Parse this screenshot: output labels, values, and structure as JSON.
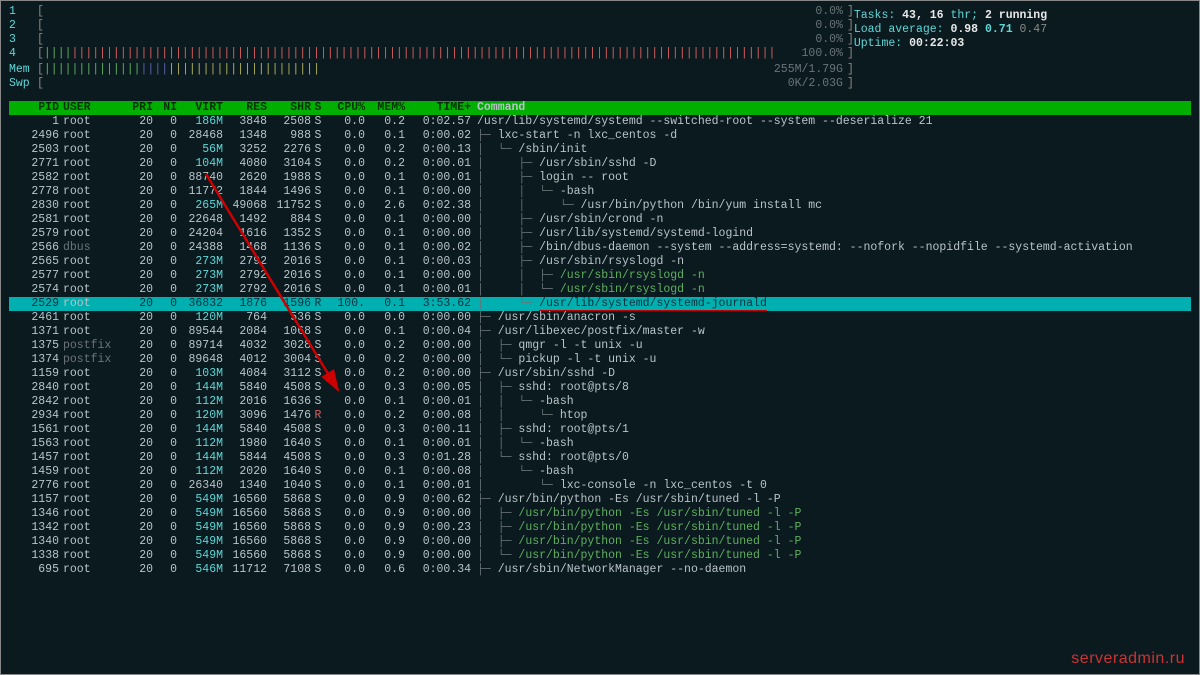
{
  "meters": {
    "cpus": [
      {
        "label": "1",
        "pct": "0.0%"
      },
      {
        "label": "2",
        "pct": "0.0%"
      },
      {
        "label": "3",
        "pct": "0.0%"
      },
      {
        "label": "4",
        "pct": "100.0%"
      }
    ],
    "mem": {
      "label": "Mem",
      "used": "255M",
      "total": "1.79G"
    },
    "swap": {
      "label": "Swp",
      "used": "0K",
      "total": "2.03G"
    }
  },
  "info": {
    "tasks_label": "Tasks: ",
    "tasks": "43, 16",
    "thr_label": " thr; ",
    "running": "2 running",
    "load_label": "Load average: ",
    "load1": "0.98",
    "load2": "0.71",
    "load3": "0.47",
    "uptime_label": "Uptime: ",
    "uptime": "00:22:03"
  },
  "headers": {
    "pid": "PID",
    "user": "USER",
    "pri": "PRI",
    "ni": "NI",
    "virt": "VIRT",
    "res": "RES",
    "shr": "SHR",
    "s": "S",
    "cpu": "CPU%",
    "mem": "MEM%",
    "time": "TIME+",
    "cmd": "Command"
  },
  "watermark": "serveradmin.ru",
  "procs": [
    {
      "pid": "1",
      "user": "root",
      "pri": "20",
      "ni": "0",
      "virt": "186M",
      "res": "3848",
      "shr": "2508",
      "s": "S",
      "cpu": "0.0",
      "mem": "0.2",
      "time": "0:02.57",
      "tree": "",
      "cmd": "/usr/lib/systemd/systemd --switched-root --system --deserialize 21"
    },
    {
      "pid": "2496",
      "user": "root",
      "pri": "20",
      "ni": "0",
      "virt": "28468",
      "res": "1348",
      "shr": "988",
      "s": "S",
      "cpu": "0.0",
      "mem": "0.1",
      "time": "0:00.02",
      "tree": "├─ ",
      "cmd": "lxc-start -n lxc_centos -d"
    },
    {
      "pid": "2503",
      "user": "root",
      "pri": "20",
      "ni": "0",
      "virt": "56M",
      "res": "3252",
      "shr": "2276",
      "s": "S",
      "cpu": "0.0",
      "mem": "0.2",
      "time": "0:00.13",
      "tree": "│  └─ ",
      "cmd": "/sbin/init"
    },
    {
      "pid": "2771",
      "user": "root",
      "pri": "20",
      "ni": "0",
      "virt": "104M",
      "res": "4080",
      "shr": "3104",
      "s": "S",
      "cpu": "0.0",
      "mem": "0.2",
      "time": "0:00.01",
      "tree": "│     ├─ ",
      "cmd": "/usr/sbin/sshd -D"
    },
    {
      "pid": "2582",
      "user": "root",
      "pri": "20",
      "ni": "0",
      "virt": "88740",
      "res": "2620",
      "shr": "1988",
      "s": "S",
      "cpu": "0.0",
      "mem": "0.1",
      "time": "0:00.01",
      "tree": "│     ├─ ",
      "cmd": "login -- root"
    },
    {
      "pid": "2778",
      "user": "root",
      "pri": "20",
      "ni": "0",
      "virt": "11772",
      "res": "1844",
      "shr": "1496",
      "s": "S",
      "cpu": "0.0",
      "mem": "0.1",
      "time": "0:00.00",
      "tree": "│     │  └─ ",
      "cmd": "-bash"
    },
    {
      "pid": "2830",
      "user": "root",
      "pri": "20",
      "ni": "0",
      "virt": "265M",
      "res": "49068",
      "shr": "11752",
      "s": "S",
      "cpu": "0.0",
      "mem": "2.6",
      "time": "0:02.38",
      "tree": "│     │     └─ ",
      "cmd": "/usr/bin/python /bin/yum install mc"
    },
    {
      "pid": "2581",
      "user": "root",
      "pri": "20",
      "ni": "0",
      "virt": "22648",
      "res": "1492",
      "shr": "884",
      "s": "S",
      "cpu": "0.0",
      "mem": "0.1",
      "time": "0:00.00",
      "tree": "│     ├─ ",
      "cmd": "/usr/sbin/crond -n"
    },
    {
      "pid": "2579",
      "user": "root",
      "pri": "20",
      "ni": "0",
      "virt": "24204",
      "res": "1616",
      "shr": "1352",
      "s": "S",
      "cpu": "0.0",
      "mem": "0.1",
      "time": "0:00.00",
      "tree": "│     ├─ ",
      "cmd": "/usr/lib/systemd/systemd-logind"
    },
    {
      "pid": "2566",
      "user": "dbus",
      "userDim": true,
      "pri": "20",
      "ni": "0",
      "virt": "24388",
      "res": "1468",
      "shr": "1136",
      "s": "S",
      "cpu": "0.0",
      "mem": "0.1",
      "time": "0:00.02",
      "tree": "│     ├─ ",
      "cmd": "/bin/dbus-daemon --system --address=systemd: --nofork --nopidfile --systemd-activation"
    },
    {
      "pid": "2565",
      "user": "root",
      "pri": "20",
      "ni": "0",
      "virt": "273M",
      "res": "2792",
      "shr": "2016",
      "s": "S",
      "cpu": "0.0",
      "mem": "0.1",
      "time": "0:00.03",
      "tree": "│     ├─ ",
      "cmd": "/usr/sbin/rsyslogd -n"
    },
    {
      "pid": "2577",
      "user": "root",
      "pri": "20",
      "ni": "0",
      "virt": "273M",
      "res": "2792",
      "shr": "2016",
      "s": "S",
      "cpu": "0.0",
      "mem": "0.1",
      "time": "0:00.00",
      "tree": "│     │  ├─ ",
      "cmd": "/usr/sbin/rsyslogd -n",
      "cmdGreen": true
    },
    {
      "pid": "2574",
      "user": "root",
      "pri": "20",
      "ni": "0",
      "virt": "273M",
      "res": "2792",
      "shr": "2016",
      "s": "S",
      "cpu": "0.0",
      "mem": "0.1",
      "time": "0:00.01",
      "tree": "│     │  └─ ",
      "cmd": "/usr/sbin/rsyslogd -n",
      "cmdGreen": true
    },
    {
      "pid": "2529",
      "user": "root",
      "pri": "20",
      "ni": "0",
      "virt": "36832",
      "res": "1876",
      "shr": "1596",
      "s": "R",
      "cpu": "100.",
      "mem": "0.1",
      "time": "3:53.62",
      "tree": "│     └─ ",
      "cmd": "/usr/lib/systemd/systemd-journald",
      "hl": true,
      "underline": true
    },
    {
      "pid": "2461",
      "user": "root",
      "pri": "20",
      "ni": "0",
      "virt": "120M",
      "res": "764",
      "shr": "536",
      "s": "S",
      "cpu": "0.0",
      "mem": "0.0",
      "time": "0:00.00",
      "tree": "├─ ",
      "cmd": "/usr/sbin/anacron -s"
    },
    {
      "pid": "1371",
      "user": "root",
      "pri": "20",
      "ni": "0",
      "virt": "89544",
      "res": "2084",
      "shr": "1068",
      "s": "S",
      "cpu": "0.0",
      "mem": "0.1",
      "time": "0:00.04",
      "tree": "├─ ",
      "cmd": "/usr/libexec/postfix/master -w"
    },
    {
      "pid": "1375",
      "user": "postfix",
      "userDim": true,
      "pri": "20",
      "ni": "0",
      "virt": "89714",
      "res": "4032",
      "shr": "3028",
      "s": "S",
      "cpu": "0.0",
      "mem": "0.2",
      "time": "0:00.00",
      "tree": "│  ├─ ",
      "cmd": "qmgr -l -t unix -u"
    },
    {
      "pid": "1374",
      "user": "postfix",
      "userDim": true,
      "pri": "20",
      "ni": "0",
      "virt": "89648",
      "res": "4012",
      "shr": "3004",
      "s": "S",
      "cpu": "0.0",
      "mem": "0.2",
      "time": "0:00.00",
      "tree": "│  └─ ",
      "cmd": "pickup -l -t unix -u"
    },
    {
      "pid": "1159",
      "user": "root",
      "pri": "20",
      "ni": "0",
      "virt": "103M",
      "res": "4084",
      "shr": "3112",
      "s": "S",
      "cpu": "0.0",
      "mem": "0.2",
      "time": "0:00.00",
      "tree": "├─ ",
      "cmd": "/usr/sbin/sshd -D"
    },
    {
      "pid": "2840",
      "user": "root",
      "pri": "20",
      "ni": "0",
      "virt": "144M",
      "res": "5840",
      "shr": "4508",
      "s": "S",
      "cpu": "0.0",
      "mem": "0.3",
      "time": "0:00.05",
      "tree": "│  ├─ ",
      "cmd": "sshd: root@pts/8"
    },
    {
      "pid": "2842",
      "user": "root",
      "pri": "20",
      "ni": "0",
      "virt": "112M",
      "res": "2016",
      "shr": "1636",
      "s": "S",
      "cpu": "0.0",
      "mem": "0.1",
      "time": "0:00.01",
      "tree": "│  │  └─ ",
      "cmd": "-bash"
    },
    {
      "pid": "2934",
      "user": "root",
      "pri": "20",
      "ni": "0",
      "virt": "120M",
      "res": "3096",
      "shr": "1476",
      "s": "R",
      "stateR": true,
      "cpu": "0.0",
      "mem": "0.2",
      "time": "0:00.08",
      "tree": "│  │     └─ ",
      "cmd": "htop"
    },
    {
      "pid": "1561",
      "user": "root",
      "pri": "20",
      "ni": "0",
      "virt": "144M",
      "res": "5840",
      "shr": "4508",
      "s": "S",
      "cpu": "0.0",
      "mem": "0.3",
      "time": "0:00.11",
      "tree": "│  ├─ ",
      "cmd": "sshd: root@pts/1"
    },
    {
      "pid": "1563",
      "user": "root",
      "pri": "20",
      "ni": "0",
      "virt": "112M",
      "res": "1980",
      "shr": "1640",
      "s": "S",
      "cpu": "0.0",
      "mem": "0.1",
      "time": "0:00.01",
      "tree": "│  │  └─ ",
      "cmd": "-bash"
    },
    {
      "pid": "1457",
      "user": "root",
      "pri": "20",
      "ni": "0",
      "virt": "144M",
      "res": "5844",
      "shr": "4508",
      "s": "S",
      "cpu": "0.0",
      "mem": "0.3",
      "time": "0:01.28",
      "tree": "│  └─ ",
      "cmd": "sshd: root@pts/0"
    },
    {
      "pid": "1459",
      "user": "root",
      "pri": "20",
      "ni": "0",
      "virt": "112M",
      "res": "2020",
      "shr": "1640",
      "s": "S",
      "cpu": "0.0",
      "mem": "0.1",
      "time": "0:00.08",
      "tree": "│     └─ ",
      "cmd": "-bash"
    },
    {
      "pid": "2776",
      "user": "root",
      "pri": "20",
      "ni": "0",
      "virt": "26340",
      "res": "1340",
      "shr": "1040",
      "s": "S",
      "cpu": "0.0",
      "mem": "0.1",
      "time": "0:00.01",
      "tree": "│        └─ ",
      "cmd": "lxc-console -n lxc_centos -t 0"
    },
    {
      "pid": "1157",
      "user": "root",
      "pri": "20",
      "ni": "0",
      "virt": "549M",
      "res": "16560",
      "shr": "5868",
      "s": "S",
      "cpu": "0.0",
      "mem": "0.9",
      "time": "0:00.62",
      "tree": "├─ ",
      "cmd": "/usr/bin/python -Es /usr/sbin/tuned -l -P"
    },
    {
      "pid": "1346",
      "user": "root",
      "pri": "20",
      "ni": "0",
      "virt": "549M",
      "res": "16560",
      "shr": "5868",
      "s": "S",
      "cpu": "0.0",
      "mem": "0.9",
      "time": "0:00.00",
      "tree": "│  ├─ ",
      "cmd": "/usr/bin/python -Es /usr/sbin/tuned -l -P",
      "cmdGreen": true
    },
    {
      "pid": "1342",
      "user": "root",
      "pri": "20",
      "ni": "0",
      "virt": "549M",
      "res": "16560",
      "shr": "5868",
      "s": "S",
      "cpu": "0.0",
      "mem": "0.9",
      "time": "0:00.23",
      "tree": "│  ├─ ",
      "cmd": "/usr/bin/python -Es /usr/sbin/tuned -l -P",
      "cmdGreen": true
    },
    {
      "pid": "1340",
      "user": "root",
      "pri": "20",
      "ni": "0",
      "virt": "549M",
      "res": "16560",
      "shr": "5868",
      "s": "S",
      "cpu": "0.0",
      "mem": "0.9",
      "time": "0:00.00",
      "tree": "│  ├─ ",
      "cmd": "/usr/bin/python -Es /usr/sbin/tuned -l -P",
      "cmdGreen": true
    },
    {
      "pid": "1338",
      "user": "root",
      "pri": "20",
      "ni": "0",
      "virt": "549M",
      "res": "16560",
      "shr": "5868",
      "s": "S",
      "cpu": "0.0",
      "mem": "0.9",
      "time": "0:00.00",
      "tree": "│  └─ ",
      "cmd": "/usr/bin/python -Es /usr/sbin/tuned -l -P",
      "cmdGreen": true
    },
    {
      "pid": "695",
      "user": "root",
      "pri": "20",
      "ni": "0",
      "virt": "546M",
      "res": "11712",
      "shr": "7108",
      "s": "S",
      "cpu": "0.0",
      "mem": "0.6",
      "time": "0:00.34",
      "tree": "├─ ",
      "cmd": "/usr/sbin/NetworkManager --no-daemon"
    }
  ]
}
